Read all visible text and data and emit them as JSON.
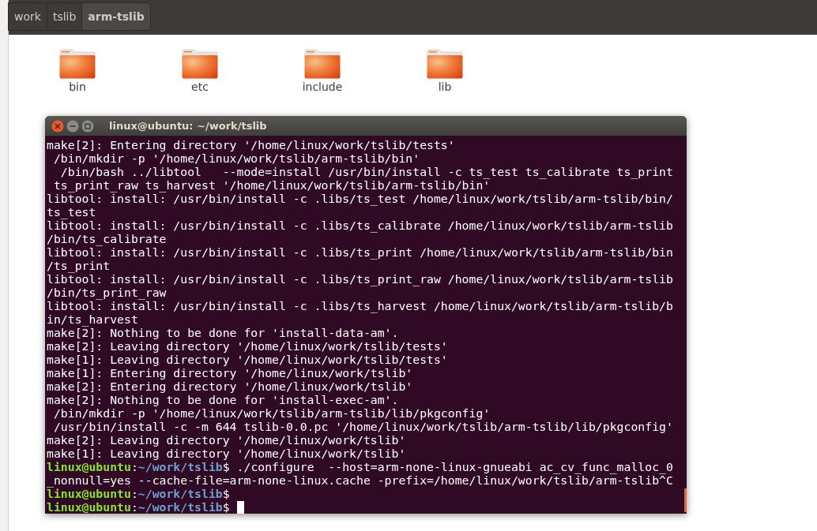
{
  "breadcrumbs": [
    {
      "label": "work",
      "selected": false
    },
    {
      "label": "tslib",
      "selected": false
    },
    {
      "label": "arm-tslib",
      "selected": true
    }
  ],
  "folders": [
    {
      "name": "bin"
    },
    {
      "name": "etc"
    },
    {
      "name": "include"
    },
    {
      "name": "lib"
    }
  ],
  "terminal": {
    "title": "linux@ubuntu: ~/work/tslib",
    "lines": [
      {
        "kind": "output",
        "text": "make[2]: Entering directory '/home/linux/work/tslib/tests'"
      },
      {
        "kind": "output",
        "text": " /bin/mkdir -p '/home/linux/work/tslib/arm-tslib/bin'"
      },
      {
        "kind": "output",
        "text": "  /bin/bash ../libtool   --mode=install /usr/bin/install -c ts_test ts_calibrate ts_print"
      },
      {
        "kind": "output",
        "text": " ts_print_raw ts_harvest '/home/linux/work/tslib/arm-tslib/bin'"
      },
      {
        "kind": "output",
        "text": "libtool: install: /usr/bin/install -c .libs/ts_test /home/linux/work/tslib/arm-tslib/bin/"
      },
      {
        "kind": "output",
        "text": "ts_test"
      },
      {
        "kind": "output",
        "text": "libtool: install: /usr/bin/install -c .libs/ts_calibrate /home/linux/work/tslib/arm-tslib"
      },
      {
        "kind": "output",
        "text": "/bin/ts_calibrate"
      },
      {
        "kind": "output",
        "text": "libtool: install: /usr/bin/install -c .libs/ts_print /home/linux/work/tslib/arm-tslib/bin"
      },
      {
        "kind": "output",
        "text": "/ts_print"
      },
      {
        "kind": "output",
        "text": "libtool: install: /usr/bin/install -c .libs/ts_print_raw /home/linux/work/tslib/arm-tslib"
      },
      {
        "kind": "output",
        "text": "/bin/ts_print_raw"
      },
      {
        "kind": "output",
        "text": "libtool: install: /usr/bin/install -c .libs/ts_harvest /home/linux/work/tslib/arm-tslib/b"
      },
      {
        "kind": "output",
        "text": "in/ts_harvest"
      },
      {
        "kind": "output",
        "text": "make[2]: Nothing to be done for 'install-data-am'."
      },
      {
        "kind": "output",
        "text": "make[2]: Leaving directory '/home/linux/work/tslib/tests'"
      },
      {
        "kind": "output",
        "text": "make[1]: Leaving directory '/home/linux/work/tslib/tests'"
      },
      {
        "kind": "output",
        "text": "make[1]: Entering directory '/home/linux/work/tslib'"
      },
      {
        "kind": "output",
        "text": "make[2]: Entering directory '/home/linux/work/tslib'"
      },
      {
        "kind": "output",
        "text": "make[2]: Nothing to be done for 'install-exec-am'."
      },
      {
        "kind": "output",
        "text": " /bin/mkdir -p '/home/linux/work/tslib/arm-tslib/lib/pkgconfig'"
      },
      {
        "kind": "output",
        "text": " /usr/bin/install -c -m 644 tslib-0.0.pc '/home/linux/work/tslib/arm-tslib/lib/pkgconfig'"
      },
      {
        "kind": "output",
        "text": "make[2]: Leaving directory '/home/linux/work/tslib'"
      },
      {
        "kind": "output",
        "text": "make[1]: Leaving directory '/home/linux/work/tslib'"
      },
      {
        "kind": "prompt",
        "user": "linux@ubuntu",
        "separator": ":",
        "path": "~/work/tslib",
        "dollar": "$",
        "command": " ./configure  --host=arm-none-linux-gnueabi ac_cv_func_malloc_0"
      },
      {
        "kind": "output",
        "text": "_nonnull=yes --cache-file=arm-none-linux.cache -prefix=/home/linux/work/tslib/arm-tslib^C"
      },
      {
        "kind": "prompt",
        "user": "linux@ubuntu",
        "separator": ":",
        "path": "~/work/tslib",
        "dollar": "$"
      },
      {
        "kind": "prompt",
        "user": "linux@ubuntu",
        "separator": ":",
        "path": "~/work/tslib",
        "dollar": "$",
        "cursor": true
      }
    ]
  }
}
